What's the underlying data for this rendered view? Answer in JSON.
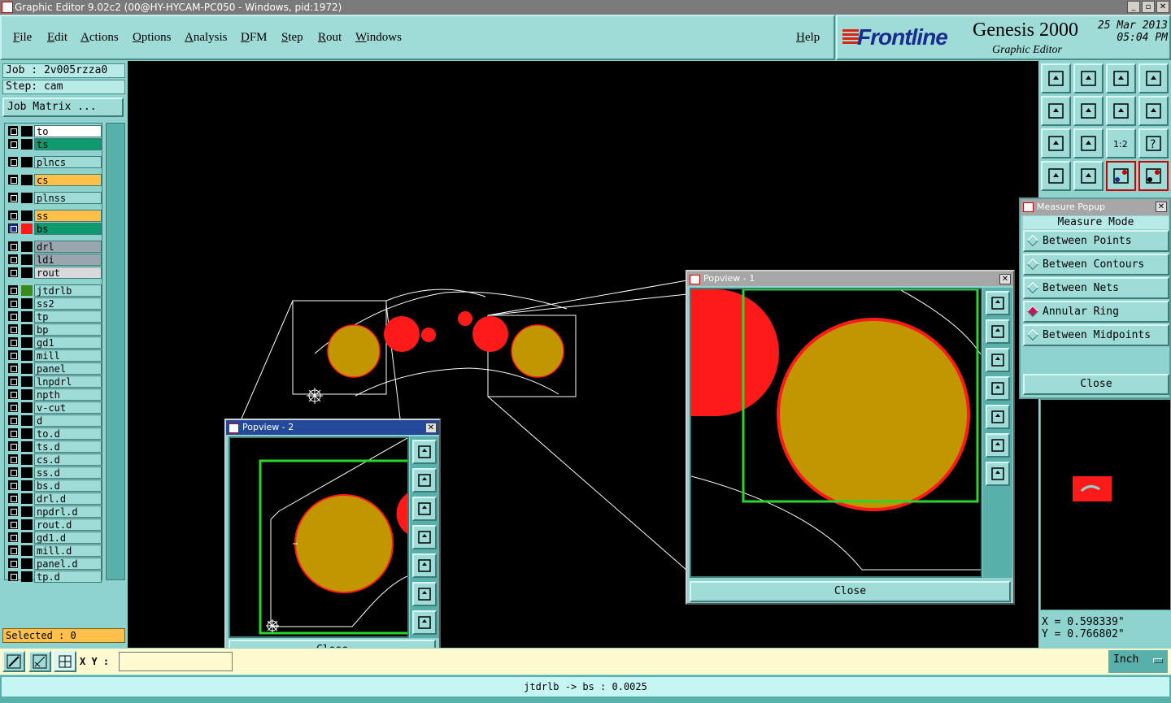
{
  "window": {
    "title": "Graphic Editor 9.02c2 (00@HY-HYCAM-PC050 - Windows, pid:1972)",
    "controls": [
      "_",
      "▫",
      "✕"
    ]
  },
  "menu": {
    "items": [
      "File",
      "Edit",
      "Actions",
      "Options",
      "Analysis",
      "DFM",
      "Step",
      "Rout",
      "Windows"
    ],
    "help": "Help"
  },
  "logo": {
    "brand": "Frontline",
    "product": "Genesis 2000",
    "subtitle": "Graphic Editor",
    "date": "25 Mar 2013",
    "time": "05:04 PM"
  },
  "job": {
    "job_label": "Job : 2v005rzza0",
    "step_label": "Step: cam",
    "matrix_button": "Job Matrix ..."
  },
  "layers": [
    {
      "name": "to",
      "color": "#ffffff"
    },
    {
      "name": "ts",
      "color": "#0e9a6e"
    },
    {
      "name": "plncs",
      "color": "#9fdcd8"
    },
    {
      "name": "cs",
      "color": "#ffc04a"
    },
    {
      "name": "plnss",
      "color": "#9fdcd8"
    },
    {
      "name": "ss",
      "color": "#ffc04a"
    },
    {
      "name": "bs",
      "color": "#0e9a6e"
    },
    {
      "name": "drl",
      "color": "#9aa6ad"
    },
    {
      "name": "ldi",
      "color": "#9aa6ad"
    },
    {
      "name": "rout",
      "color": "#d9d9d9"
    },
    {
      "name": "jtdrlb",
      "color": "#9fdcd8"
    },
    {
      "name": "ss2",
      "color": "#9fdcd8"
    },
    {
      "name": "tp",
      "color": "#9fdcd8"
    },
    {
      "name": "bp",
      "color": "#9fdcd8"
    },
    {
      "name": "gd1",
      "color": "#9fdcd8"
    },
    {
      "name": "mill",
      "color": "#9fdcd8"
    },
    {
      "name": "panel",
      "color": "#9fdcd8"
    },
    {
      "name": "lnpdrl",
      "color": "#9fdcd8"
    },
    {
      "name": "npth",
      "color": "#9fdcd8"
    },
    {
      "name": "v-cut",
      "color": "#9fdcd8"
    },
    {
      "name": "d",
      "color": "#9fdcd8"
    },
    {
      "name": "to.d",
      "color": "#9fdcd8"
    },
    {
      "name": "ts.d",
      "color": "#9fdcd8"
    },
    {
      "name": "cs.d",
      "color": "#9fdcd8"
    },
    {
      "name": "ss.d",
      "color": "#9fdcd8"
    },
    {
      "name": "bs.d",
      "color": "#9fdcd8"
    },
    {
      "name": "drl.d",
      "color": "#9fdcd8"
    },
    {
      "name": "npdrl.d",
      "color": "#9fdcd8"
    },
    {
      "name": "rout.d",
      "color": "#9fdcd8"
    },
    {
      "name": "gd1.d",
      "color": "#9fdcd8"
    },
    {
      "name": "mill.d",
      "color": "#9fdcd8"
    },
    {
      "name": "panel.d",
      "color": "#9fdcd8"
    },
    {
      "name": "tp.d",
      "color": "#9fdcd8"
    }
  ],
  "selected_label": "Selected : 0",
  "measure": {
    "title": "Measure Popup",
    "mode_heading": "Measure Mode",
    "options": [
      {
        "label": "Between Points",
        "active": false
      },
      {
        "label": "Between Contours",
        "active": false
      },
      {
        "label": "Between Nets",
        "active": false
      },
      {
        "label": "Annular Ring",
        "active": true
      },
      {
        "label": "Between Midpoints",
        "active": false
      }
    ],
    "close_label": "Close"
  },
  "popview1": {
    "title": "Popview - 1",
    "close_label": "Close"
  },
  "popview2": {
    "title": "Popview - 2",
    "close_label": "Close"
  },
  "coords": {
    "x": "X = 0.598339\"",
    "y": "Y = 0.766802\""
  },
  "bottom": {
    "xy_label": "X Y :",
    "xy_value": "",
    "units": "Inch"
  },
  "status_message": "jtdrlb -> bs : 0.0025",
  "colors": {
    "panel": "#8fd3cf",
    "pad_fill": "#c19600",
    "pad_ring": "#ff1a1a",
    "highlight_box": "#2bd62b",
    "accent_orange": "#ffc04a"
  }
}
